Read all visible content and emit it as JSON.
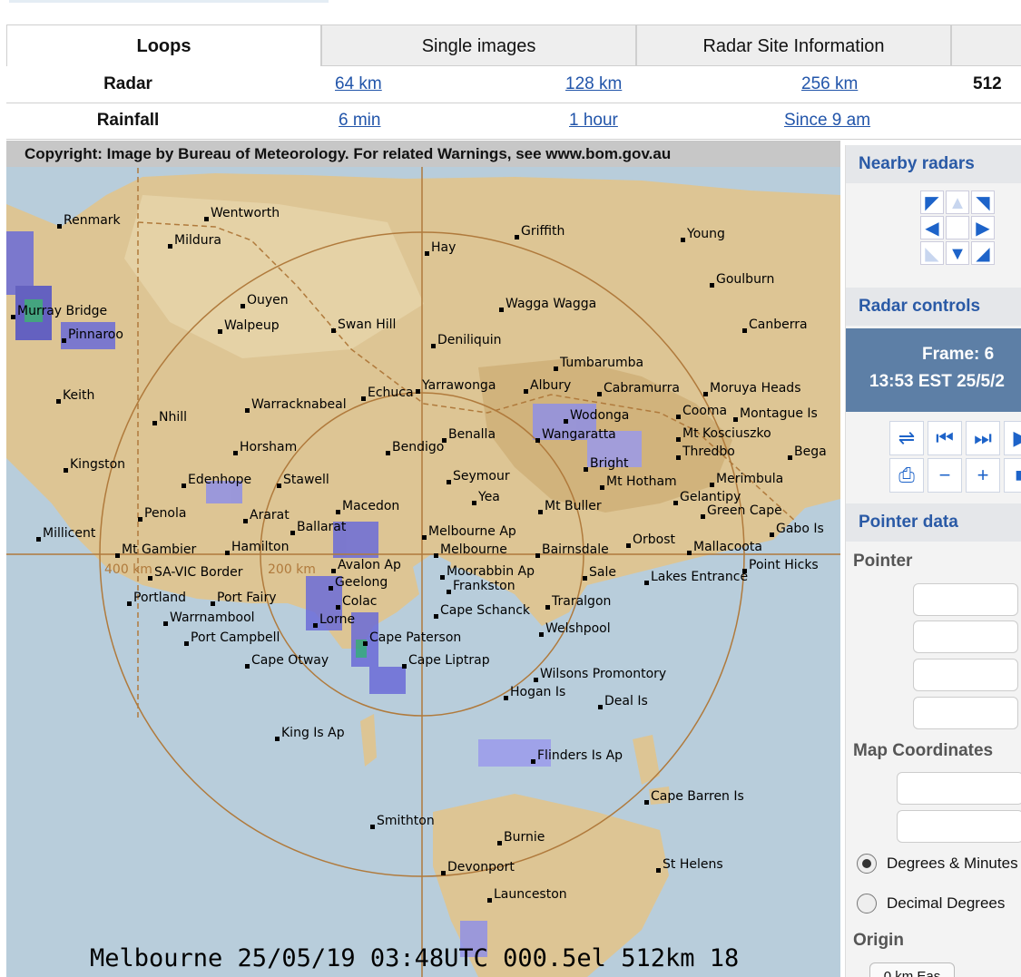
{
  "tabs": [
    "Loops",
    "Single images",
    "Radar Site Information",
    ""
  ],
  "radar_row": {
    "head": "Radar",
    "links": [
      "64 km",
      "128 km",
      "256 km",
      "512"
    ]
  },
  "rainfall_row": {
    "head": "Rainfall",
    "links": [
      "6 min",
      "1 hour",
      "Since 9 am"
    ]
  },
  "map": {
    "copyright": "Copyright: Image by Bureau of Meteorology. For related Warnings, see www.bom.gov.au",
    "caption": "Melbourne 25/05/19 03:48UTC 000.5el 512km 18",
    "range_labels": [
      "400 km",
      "200 km"
    ],
    "places": [
      "Renmark",
      "Wentworth",
      "Mildura",
      "Griffith",
      "Young",
      "Hay",
      "Goulburn",
      "Ouyen",
      "Murray Bridge",
      "Walpeup",
      "Swan Hill",
      "Wagga Wagga",
      "Canberra",
      "Pinnaroo",
      "Deniliquin",
      "Tumbarumba",
      "Keith",
      "Echuca",
      "Yarrawonga",
      "Albury",
      "Cabramurra",
      "Moruya Heads",
      "Nhill",
      "Warracknabeal",
      "Wodonga",
      "Cooma",
      "Montague Is",
      "Benalla",
      "Wangaratta",
      "Mt Kosciuszko",
      "Horsham",
      "Bendigo",
      "Thredbo",
      "Bega",
      "Kingston",
      "Bright",
      "Edenhope",
      "Stawell",
      "Seymour",
      "Mt Hotham",
      "Merimbula",
      "Yea",
      "Gelantipy",
      "Penola",
      "Ararat",
      "Macedon",
      "Mt Buller",
      "Green Cape",
      "Ballarat",
      "Melbourne Ap",
      "Gabo Is",
      "Millicent",
      "Mt Gambier",
      "Hamilton",
      "Melbourne",
      "Bairnsdale",
      "Orbost",
      "Mallacoota",
      "SA-VIC Border",
      "Avalon Ap",
      "Moorabbin Ap",
      "Sale",
      "Point Hicks",
      "Geelong",
      "Frankston",
      "Lakes Entrance",
      "Portland",
      "Port Fairy",
      "Colac",
      "Traralgon",
      "Warrnambool",
      "Cape Schanck",
      "Lorne",
      "Port Campbell",
      "Cape Paterson",
      "Welshpool",
      "Cape Otway",
      "Cape Liptrap",
      "Wilsons Promontory",
      "Hogan Is",
      "Deal Is",
      "King Is Ap",
      "Flinders Is Ap",
      "Cape Barren Is",
      "Smithton",
      "Burnie",
      "St Helens",
      "Devonport",
      "Launceston"
    ]
  },
  "panel": {
    "nearby_title": "Nearby radars",
    "controls_title": "Radar controls",
    "frame_line1": "Frame: 6",
    "frame_line2": "13:53 EST 25/5/2",
    "pointer_title": "Pointer data",
    "pointer_label": "Pointer",
    "mapcoords_label": "Map Coordinates",
    "opt_degmin": "Degrees & Minutes",
    "opt_decimal": "Decimal Degrees",
    "origin_label": "Origin",
    "origin_value": "0 km Eas"
  },
  "colors": {
    "link": "#2255aa",
    "panel_head": "#2a5aa6",
    "frame_bg": "#5d7fa6",
    "land": "#ddc594",
    "sea": "#b8cddb"
  }
}
